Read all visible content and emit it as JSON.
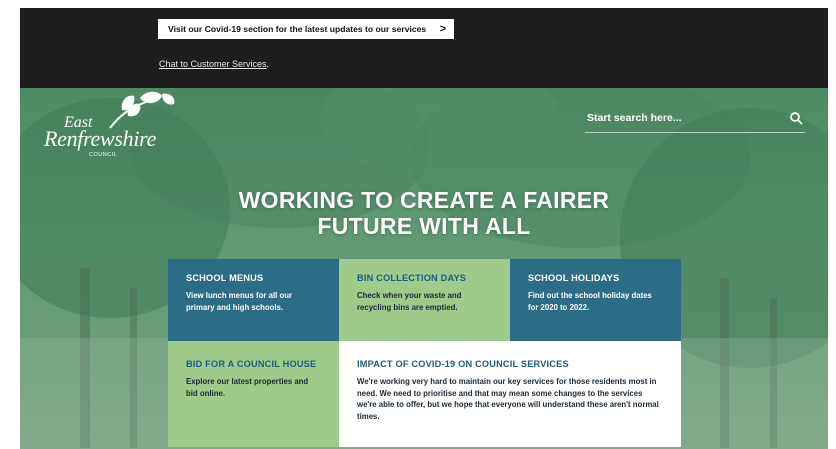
{
  "alert": {
    "covid_link": "Visit our Covid-19 section for the latest updates to our services",
    "covid_chevron": ">",
    "chat_link": "Chat to Customer Services",
    "chat_suffix": "."
  },
  "logo": {
    "line1": "East",
    "line2": "Renfrewshire",
    "line3": "COUNCIL"
  },
  "search": {
    "placeholder": "Start search here..."
  },
  "hero": {
    "headline_line1": "WORKING TO CREATE A FAIRER",
    "headline_line2": "FUTURE WITH ALL"
  },
  "cards": [
    {
      "title": "SCHOOL MENUS",
      "desc": "View lunch menus for all our primary and high schools."
    },
    {
      "title": "BIN COLLECTION DAYS",
      "desc": "Check when your waste and recycling bins are emptied."
    },
    {
      "title": "SCHOOL HOLIDAYS",
      "desc": "Find out the school holiday dates for 2020 to 2022."
    },
    {
      "title": "BID FOR A COUNCIL HOUSE",
      "desc": "Explore our latest properties and bid online."
    },
    {
      "title": "IMPACT OF COVID-19 ON COUNCIL SERVICES",
      "desc": "We're working very hard to maintain our key services for those residents most in need. We need to prioritise and that may mean some changes to the services we're able to offer, but we hope that everyone will understand these aren't normal times."
    }
  ],
  "colors": {
    "teal": "#2d6c86",
    "green": "#9ecb8a",
    "dark_bar": "#1d1d1d",
    "hero_green": "#5f9873"
  }
}
